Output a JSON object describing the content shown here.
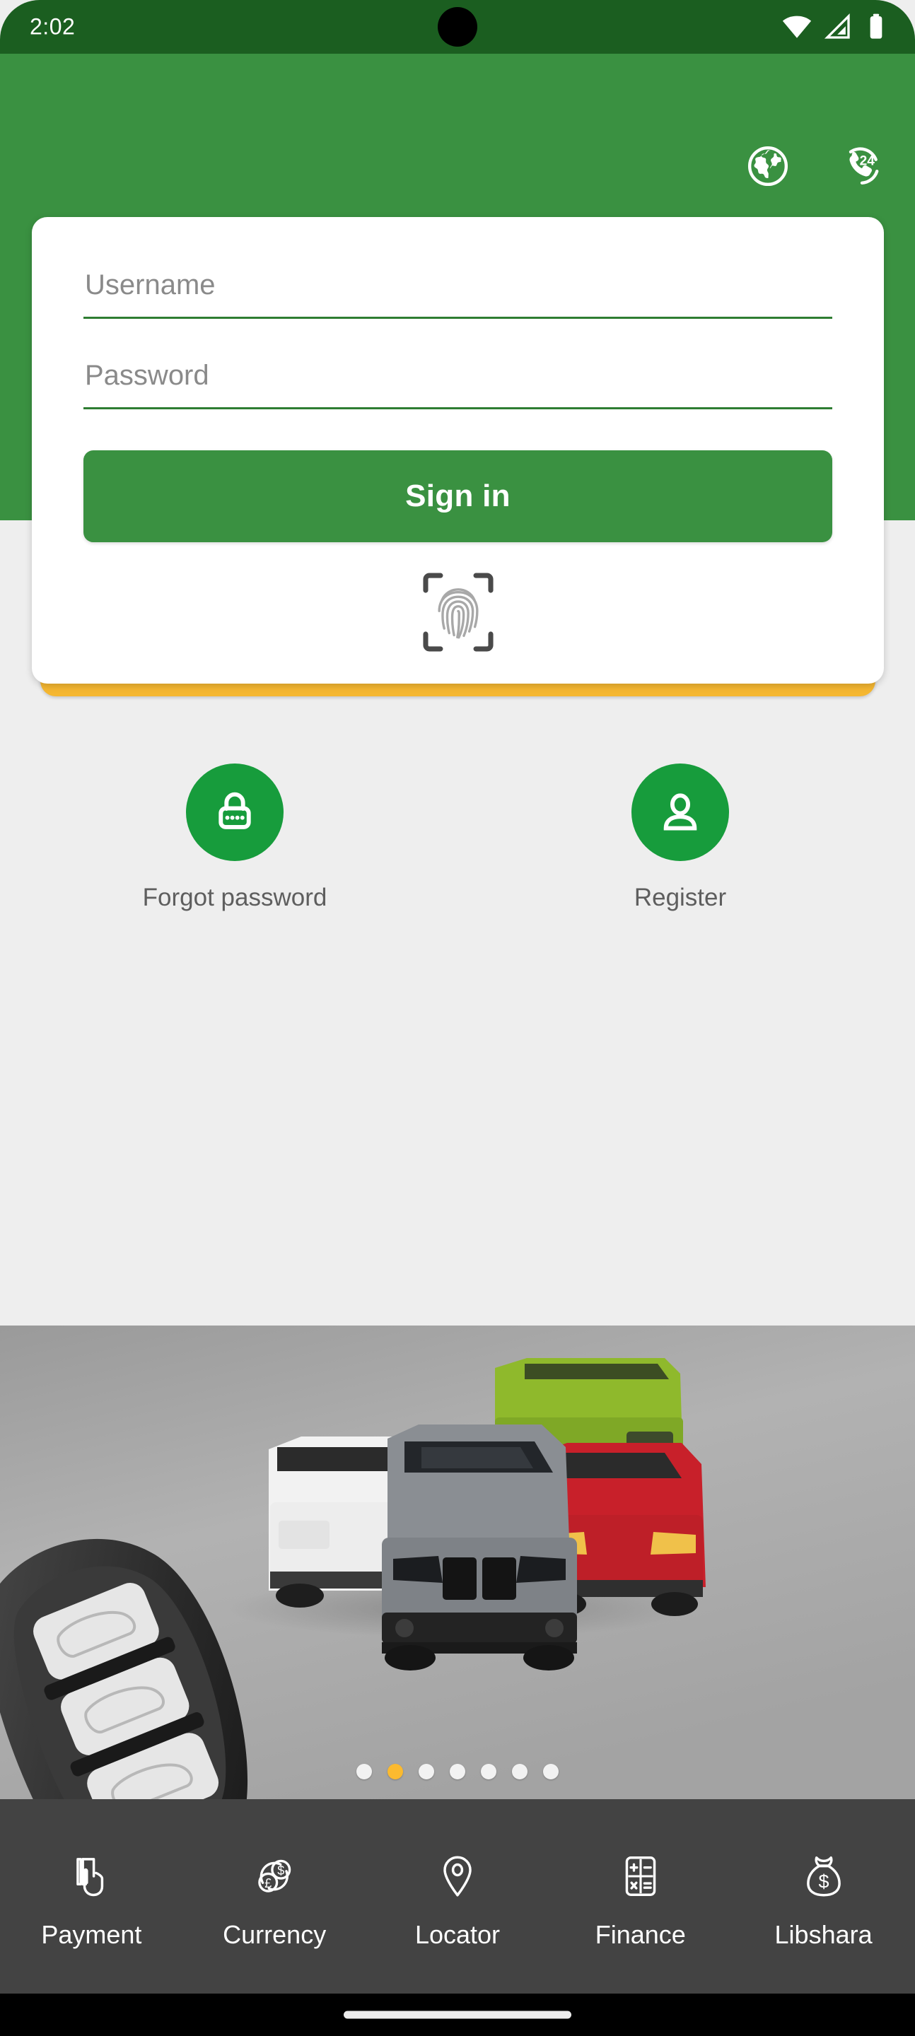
{
  "statusbar": {
    "time": "2:02",
    "icons": [
      "wifi-icon",
      "cell-signal-icon",
      "battery-icon"
    ]
  },
  "header": {
    "actions": [
      {
        "name": "globe-icon",
        "label": "Language"
      },
      {
        "name": "support-24-icon",
        "label": "24"
      }
    ],
    "support_badge_text": "24"
  },
  "login_card": {
    "username": {
      "placeholder": "Username",
      "value": ""
    },
    "password": {
      "placeholder": "Password",
      "value": ""
    },
    "signin_label": "Sign in",
    "biometric_icon": "fingerprint-scan-icon"
  },
  "quick_actions": [
    {
      "icon": "lock-icon",
      "label": "Forgot password"
    },
    {
      "icon": "person-icon",
      "label": "Register"
    }
  ],
  "promo": {
    "carousel": {
      "total_dots": 7,
      "active_index": 1
    }
  },
  "bottom_nav": [
    {
      "icon": "tap-card-icon",
      "label": "Payment"
    },
    {
      "icon": "currency-coins-icon",
      "label": "Currency"
    },
    {
      "icon": "map-pin-icon",
      "label": "Locator"
    },
    {
      "icon": "calculator-icon",
      "label": "Finance"
    },
    {
      "icon": "money-bag-icon",
      "label": "Libshara"
    }
  ],
  "colors": {
    "status_bar_green": "#1B5E20",
    "header_green": "#3A9141",
    "accent_yellow": "#F5B731",
    "carousel_active": "#FBBA2F",
    "page_background": "#EEEEEE",
    "nav_background": "#434343",
    "action_circle_green": "#179C3C"
  }
}
